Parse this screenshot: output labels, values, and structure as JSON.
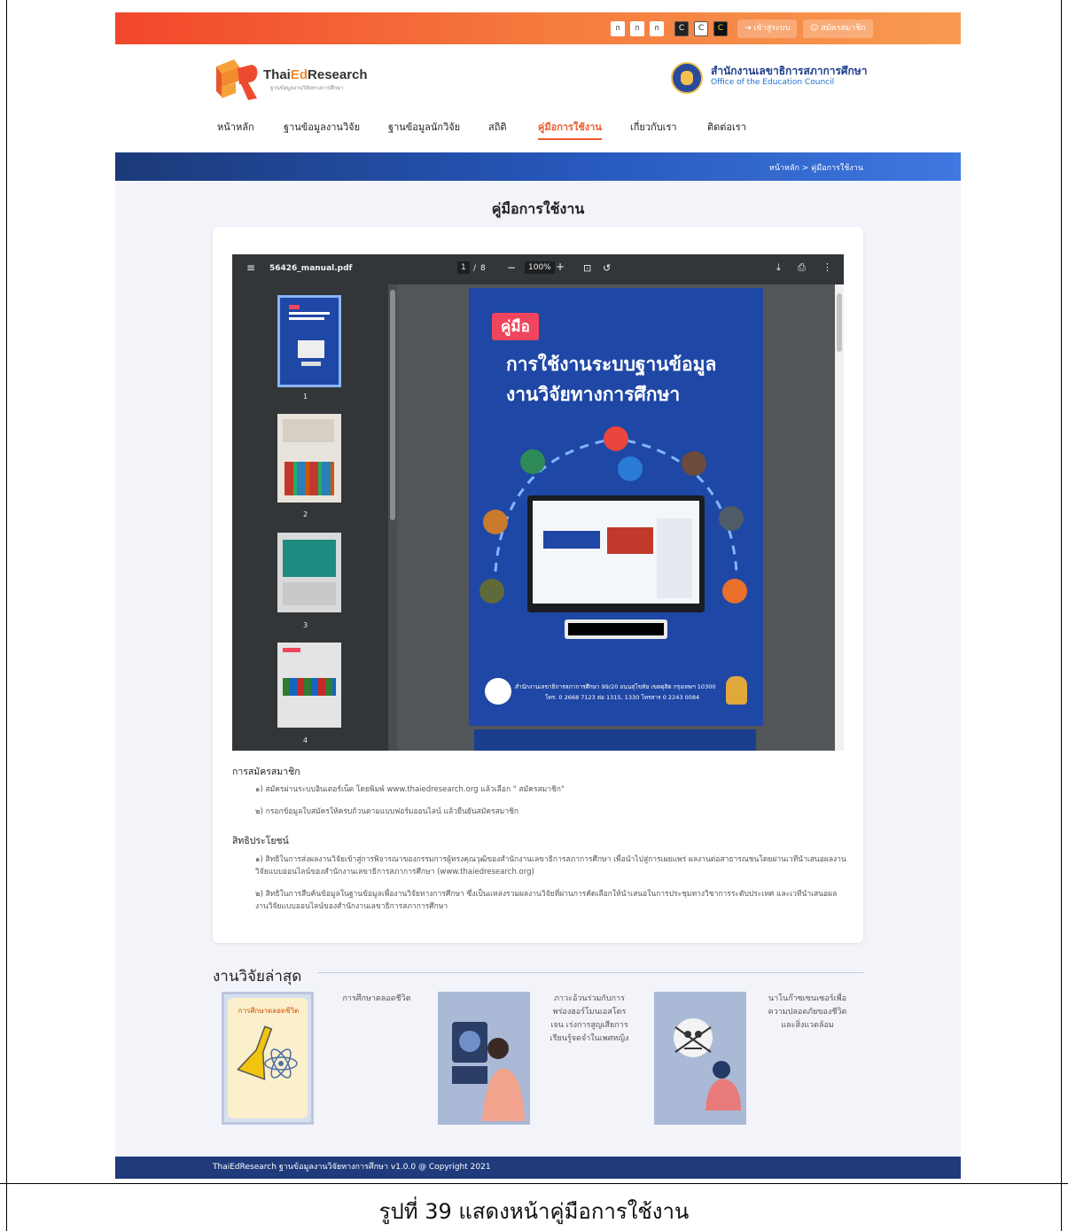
{
  "topbar": {
    "font_buttons": [
      "ก",
      "ก",
      "ก"
    ],
    "contrast_buttons": [
      "C",
      "C",
      "C"
    ],
    "login_label": "เข้าสู่ระบบ",
    "register_label": "สมัครสมาชิก"
  },
  "brand": {
    "name_part1": "Thai",
    "name_part2": "Ed",
    "name_part3": "Research",
    "tagline": "ฐานข้อมูลงานวิจัยทางการศึกษา",
    "accent_color": "#f05a2c",
    "navy_color": "#1f3b7c"
  },
  "onec": {
    "name_th": "สำนักงานเลขาธิการสภาการศึกษา",
    "name_en": "Office of the Education Council"
  },
  "nav": {
    "items": [
      "หน้าหลัก",
      "ฐานข้อมูลงานวิจัย",
      "ฐานข้อมูลนักวิจัย",
      "สถิติ",
      "คู่มือการใช้งาน",
      "เกี่ยวกับเรา",
      "ติดต่อเรา"
    ],
    "active": "คู่มือการใช้งาน"
  },
  "breadcrumb": "หน้าหลัก > คู่มือการใช้งาน",
  "page_title": "คู่มือการใช้งาน",
  "pdf_viewer": {
    "filename": "56426_manual.pdf",
    "page_current": "1",
    "page_sep": "/",
    "page_total": "8",
    "zoom": "100%",
    "thumb_numbers": [
      "1",
      "2",
      "3",
      "4"
    ],
    "cover_tag": "คู่มือ",
    "cover_title_1": "การใช้งานระบบฐานข้อมูล",
    "cover_title_2": "งานวิจัยทางการศึกษา",
    "cover_footer_1": "สำนักงานเลขาธิการสภาการศึกษา 99/20 ถนนสุโขทัย เขตดุสิต กรุงเทพฯ 10300",
    "cover_footer_2": "โทร. 0 2668 7123 ต่อ 1315, 1330 โทรสาร 0 2243 0084"
  },
  "sections": [
    {
      "heading": "การสมัครสมาชิก",
      "items": [
        "๑) สมัครผ่านระบบอินเตอร์เน็ต โดยพิมพ์ www.thaiedresearch.org แล้วเลือก \" สมัครสมาชิก\"",
        "๒) กรอกข้อมูลใบสมัครให้ครบถ้วนตามแบบฟอร์มออนไลน์ แล้วยืนยันสมัครสมาชิก"
      ]
    },
    {
      "heading": "สิทธิประโยชน์",
      "items": [
        "๑) สิทธิในการส่งผลงานวิจัยเข้าสู่การพิจารณาของกรรมการผู้ทรงคุณวุฒิของสำนักงานเลขาธิการสภาการศึกษา เพื่อนำไปสู่การเผยแพร่ ผลงานต่อสาธารณชนโดยผ่านเวทีนำเสนอผลงานวิจัยแบบออนไลน์ของสำนักงานเลขาธิการสภาการศึกษา (www.thaiedresearch.org)",
        "๒) สิทธิในการสืบค้นข้อมูลในฐานข้อมูลเพื่องานวิจัยทางการศึกษา ซึ่งเป็นแหล่งรวมผลงานวิจัยที่ผ่านการคัดเลือกให้นำเสนอในการประชุมทางวิชาการระดับประเทศ และเวทีนำเสนอผลงานวิจัยแบบออนไลน์ของสำนักงานเลขาธิการสภาการศึกษา"
      ]
    }
  ],
  "latest": {
    "title": "งานวิจัยล่าสุด",
    "items": [
      {
        "cover_text": "การศึกษาตลอดชีวิต",
        "caption": "การศึกษาตลอดชีวิต"
      },
      {
        "cover_text": "",
        "caption": "ภาวะอ้วนร่วมกับการพร่องฮอร์โมนเอสโตรเจน เร่งการสูญเสียการเรียนรู้จดจำในเพศหญิง"
      },
      {
        "cover_text": "",
        "caption": "นาโนก๊าซเซนเซอร์เพื่อความปลอดภัยของชีวิตและสิ่งแวดล้อม"
      }
    ]
  },
  "footer": "ThaiEdResearch ฐานข้อมูลงานวิจัยทางการศึกษา v1.0.0 @ Copyright 2021",
  "figure_caption": "รูปที่ 39 แสดงหน้าคู่มือการใช้งาน"
}
